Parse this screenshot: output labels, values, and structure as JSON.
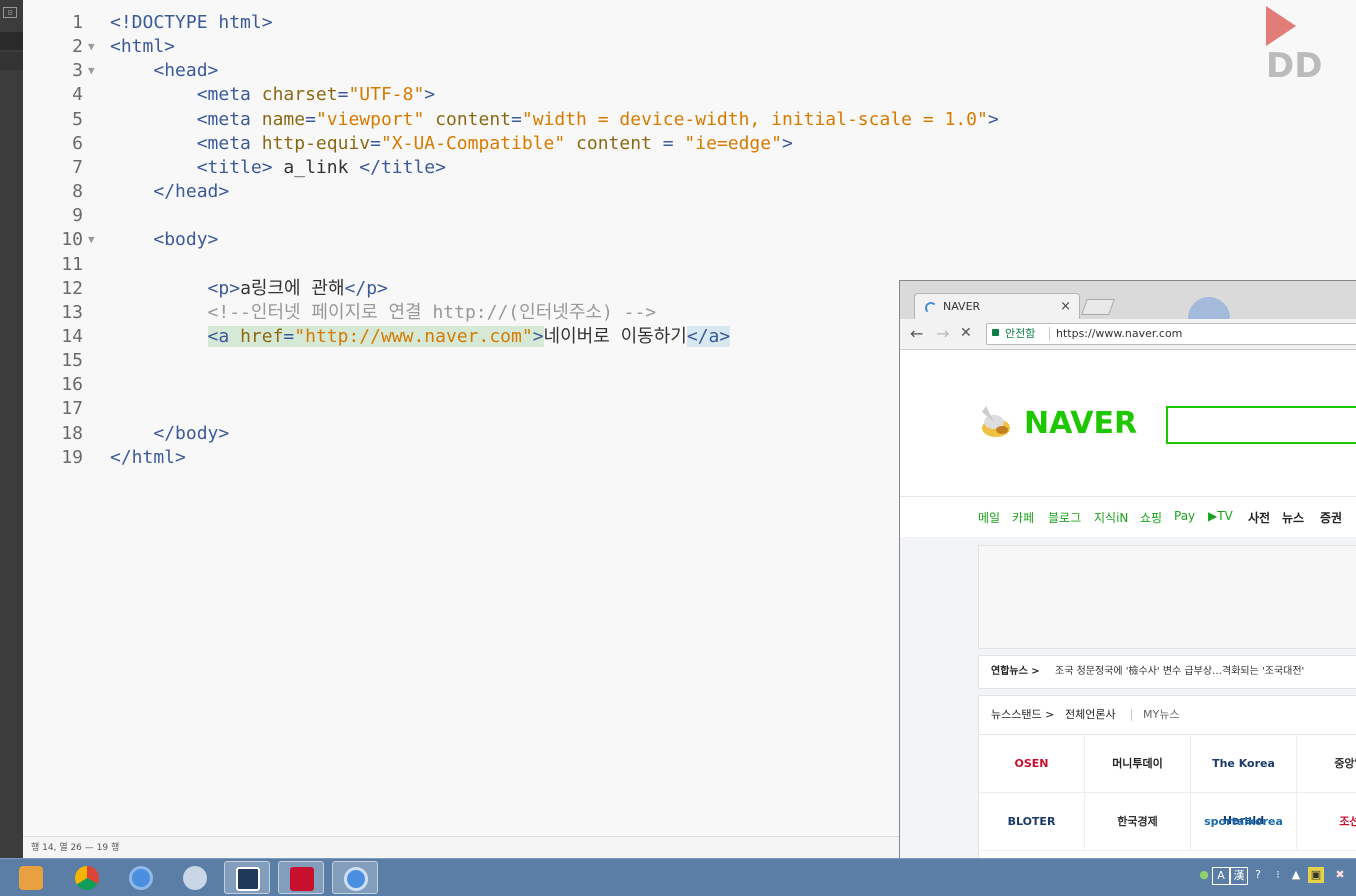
{
  "editor": {
    "lines": [
      {
        "n": "1",
        "fold": "",
        "parts": [
          [
            "tag",
            "<!DOCTYPE html>"
          ]
        ]
      },
      {
        "n": "2",
        "fold": "▼",
        "parts": [
          [
            "tag",
            "<html>"
          ]
        ]
      },
      {
        "n": "3",
        "fold": "▼",
        "parts": [
          [
            "txt",
            "    "
          ],
          [
            "tag",
            "<head>"
          ]
        ]
      },
      {
        "n": "4",
        "fold": "",
        "parts": [
          [
            "txt",
            "        "
          ],
          [
            "tag",
            "<meta "
          ],
          [
            "attr",
            "charset"
          ],
          [
            "tag",
            "="
          ],
          [
            "str",
            "\"UTF-8\""
          ],
          [
            "tag",
            ">"
          ]
        ]
      },
      {
        "n": "5",
        "fold": "",
        "parts": [
          [
            "txt",
            "        "
          ],
          [
            "tag",
            "<meta "
          ],
          [
            "attr",
            "name"
          ],
          [
            "tag",
            "="
          ],
          [
            "str",
            "\"viewport\""
          ],
          [
            "tag",
            " "
          ],
          [
            "attr",
            "content"
          ],
          [
            "tag",
            "="
          ],
          [
            "str",
            "\"width = device-width, initial-scale = 1.0\""
          ],
          [
            "tag",
            ">"
          ]
        ]
      },
      {
        "n": "6",
        "fold": "",
        "parts": [
          [
            "txt",
            "        "
          ],
          [
            "tag",
            "<meta "
          ],
          [
            "attr",
            "http-equiv"
          ],
          [
            "tag",
            "="
          ],
          [
            "str",
            "\"X-UA-Compatible\""
          ],
          [
            "tag",
            " "
          ],
          [
            "attr",
            "content"
          ],
          [
            "tag",
            " = "
          ],
          [
            "str",
            "\"ie=edge\""
          ],
          [
            "tag",
            ">"
          ]
        ]
      },
      {
        "n": "7",
        "fold": "",
        "parts": [
          [
            "txt",
            "        "
          ],
          [
            "tag",
            "<title>"
          ],
          [
            "txt",
            " a_link "
          ],
          [
            "tag",
            "</title>"
          ]
        ]
      },
      {
        "n": "8",
        "fold": "",
        "parts": [
          [
            "txt",
            "    "
          ],
          [
            "tag",
            "</head>"
          ]
        ]
      },
      {
        "n": "9",
        "fold": "",
        "parts": []
      },
      {
        "n": "10",
        "fold": "▼",
        "parts": [
          [
            "txt",
            "    "
          ],
          [
            "tag",
            "<body>"
          ]
        ]
      },
      {
        "n": "11",
        "fold": "",
        "parts": []
      },
      {
        "n": "12",
        "fold": "",
        "parts": [
          [
            "txt",
            "         "
          ],
          [
            "tag",
            "<p>"
          ],
          [
            "txt",
            "a링크에 관해"
          ],
          [
            "tag",
            "</p>"
          ]
        ]
      },
      {
        "n": "13",
        "fold": "",
        "parts": [
          [
            "txt",
            "         "
          ],
          [
            "cmt",
            "<!--인터넷 페이지로 연결 http://(인터넷주소) -->"
          ]
        ]
      },
      {
        "n": "14",
        "fold": "",
        "parts": [
          [
            "txt",
            "         "
          ],
          [
            "tag hl",
            "<a "
          ],
          [
            "attr hl",
            "href"
          ],
          [
            "tag hl",
            "="
          ],
          [
            "str hl",
            "\"http://www.naver.com\""
          ],
          [
            "tag hl",
            ">"
          ],
          [
            "txt",
            "네이버로 이동하기"
          ],
          [
            "tag hl2",
            "</a>"
          ]
        ]
      },
      {
        "n": "15",
        "fold": "",
        "parts": []
      },
      {
        "n": "16",
        "fold": "",
        "parts": []
      },
      {
        "n": "17",
        "fold": "",
        "parts": []
      },
      {
        "n": "18",
        "fold": "",
        "parts": [
          [
            "txt",
            "    "
          ],
          [
            "tag",
            "</body>"
          ]
        ]
      },
      {
        "n": "19",
        "fold": "",
        "parts": [
          [
            "tag",
            "</html>"
          ]
        ]
      }
    ],
    "status": "행 14, 열 26 — 19 행"
  },
  "logo": {
    "text": "DD"
  },
  "browser": {
    "tab_title": "NAVER",
    "tab_close": "×",
    "back": "←",
    "forward": "→",
    "stop": "✕",
    "secure_label": "안전함",
    "url": "https://www.naver.com",
    "naver_word": "NAVER",
    "menu": [
      "메일",
      "카페",
      "블로그",
      "지식iN",
      "쇼핑",
      "Pay",
      "▶TV",
      "사전",
      "뉴스",
      "증권"
    ],
    "news_source": "연합뉴스 >",
    "news_headline": "조국 청문정국에 '檢수사' 변수 급부상…격화되는 '조국대전'",
    "newsstand_label": "뉴스스탠드 >",
    "newsstand_all": "전체언론사",
    "newsstand_my": "MY뉴스",
    "press": [
      "OSEN",
      "머니투데이",
      "The Korea Herald",
      "중앙일",
      "BLOTER",
      "한국경제",
      "sportalkorea",
      "조선"
    ]
  },
  "taskbar": {
    "tray": [
      "A",
      "漢",
      "?"
    ]
  },
  "colors": {
    "naver_green": "#1ec800",
    "taskbar": "#5a7ea6"
  }
}
